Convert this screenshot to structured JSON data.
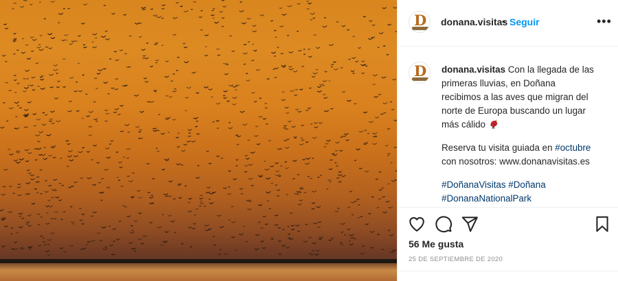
{
  "post": {
    "username": "donana.visitas",
    "follow_label": "Seguir",
    "separator": "•",
    "more_label": "•••",
    "avatar_logo": "D",
    "caption": {
      "line1": "Con la llegada de las primeras lluvias, en Doñana recibimos a las aves que migran del norte de Europa buscando un lugar más cálido",
      "line2_prefix": "Reserva tu visita guiada en",
      "line2_tag": "#octubre",
      "line2_suffix": "con nosotros: www.donanavisitas.es",
      "hashtag1": "#DoñanaVisitas",
      "hashtag2": "#Doñana",
      "hashtag3": "#DonanaNationalPark",
      "bird_emoji": "bird-icon"
    },
    "likes": "56 Me gusta",
    "date": "25 de septiembre de 2020"
  },
  "icons": {
    "like": "heart-icon",
    "comment": "comment-icon",
    "share": "paper-plane-icon",
    "save": "bookmark-icon"
  },
  "colors": {
    "follow": "#0095f6",
    "hashtag": "#00376b",
    "sky_top": "#d9861f",
    "sky_bottom": "#3e2a22"
  }
}
